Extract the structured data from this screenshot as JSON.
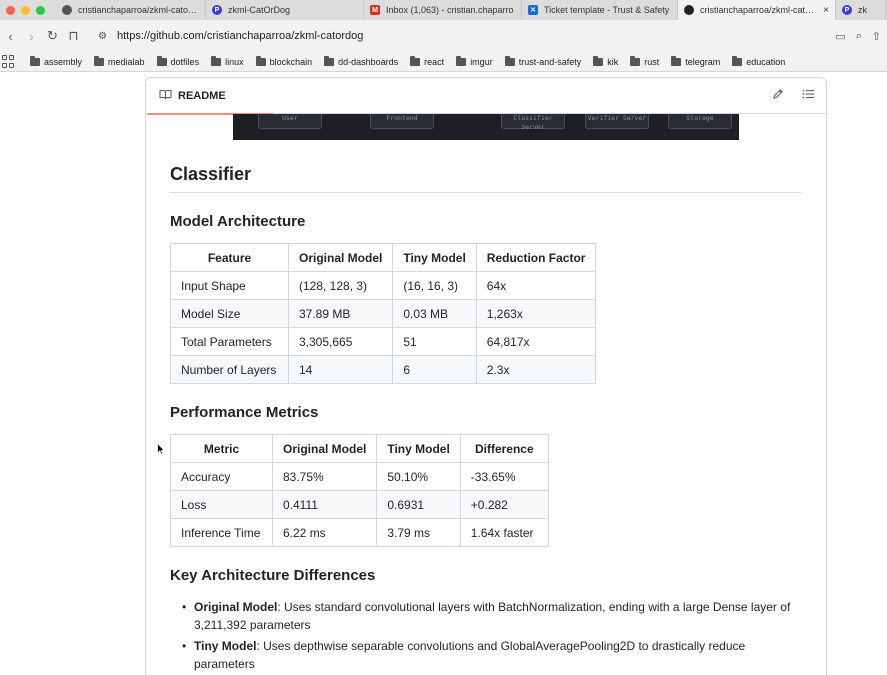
{
  "browser": {
    "tabs": [
      {
        "label": "cristianchaparroa/zkml-catordog",
        "icon": "github-icon",
        "active": false
      },
      {
        "label": "zkml-CatOrDog",
        "icon": "p-icon",
        "active": false
      },
      {
        "label": "Inbox (1,063) - cristian.chaparro",
        "icon": "gmail-icon",
        "active": false
      },
      {
        "label": "Ticket template - Trust & Safety",
        "icon": "confluence-icon",
        "active": false
      },
      {
        "label": "cristianchaparroa/zkml-catordog",
        "icon": "github-icon",
        "active": true,
        "close": "×"
      },
      {
        "label": "zk",
        "icon": "p-icon",
        "active": false
      }
    ],
    "url": "https://github.com/cristianchaparroa/zkml-catordog",
    "bookmarks": [
      "assembly",
      "medialab",
      "dotfiles",
      "linux",
      "blockchain",
      "dd-dashboards",
      "react",
      "imgur",
      "trust-and-safety",
      "kik",
      "rust",
      "telegram",
      "education"
    ]
  },
  "readme": {
    "tab_label": "README",
    "diagram_labels": [
      "User",
      "Frontend",
      "Classifier Server",
      "Verifier Server",
      "Storage"
    ],
    "h1": "Classifier",
    "model_arch": {
      "heading": "Model Architecture",
      "headers": [
        "Feature",
        "Original Model",
        "Tiny Model",
        "Reduction Factor"
      ],
      "rows": [
        [
          "Input Shape",
          "(128, 128, 3)",
          "(16, 16, 3)",
          "64x"
        ],
        [
          "Model Size",
          "37.89 MB",
          "0.03 MB",
          "1,263x"
        ],
        [
          "Total Parameters",
          "3,305,665",
          "51",
          "64,817x"
        ],
        [
          "Number of Layers",
          "14",
          "6",
          "2.3x"
        ]
      ]
    },
    "performance": {
      "heading": "Performance Metrics",
      "headers": [
        "Metric",
        "Original Model",
        "Tiny Model",
        "Difference"
      ],
      "rows": [
        [
          "Accuracy",
          "83.75%",
          "50.10%",
          "-33.65%"
        ],
        [
          "Loss",
          "0.4111",
          "0.6931",
          "+0.282"
        ],
        [
          "Inference Time",
          "6.22 ms",
          "3.79 ms",
          "1.64x faster"
        ]
      ]
    },
    "differences": {
      "heading": "Key Architecture Differences",
      "items": [
        {
          "title": "Original Model",
          "text": ": Uses standard convolutional layers with BatchNormalization, ending with a large Dense layer of 3,211,392 parameters"
        },
        {
          "title": "Tiny Model",
          "text": ": Uses depthwise separable convolutions and GlobalAveragePooling2D to drastically reduce parameters"
        }
      ]
    }
  }
}
